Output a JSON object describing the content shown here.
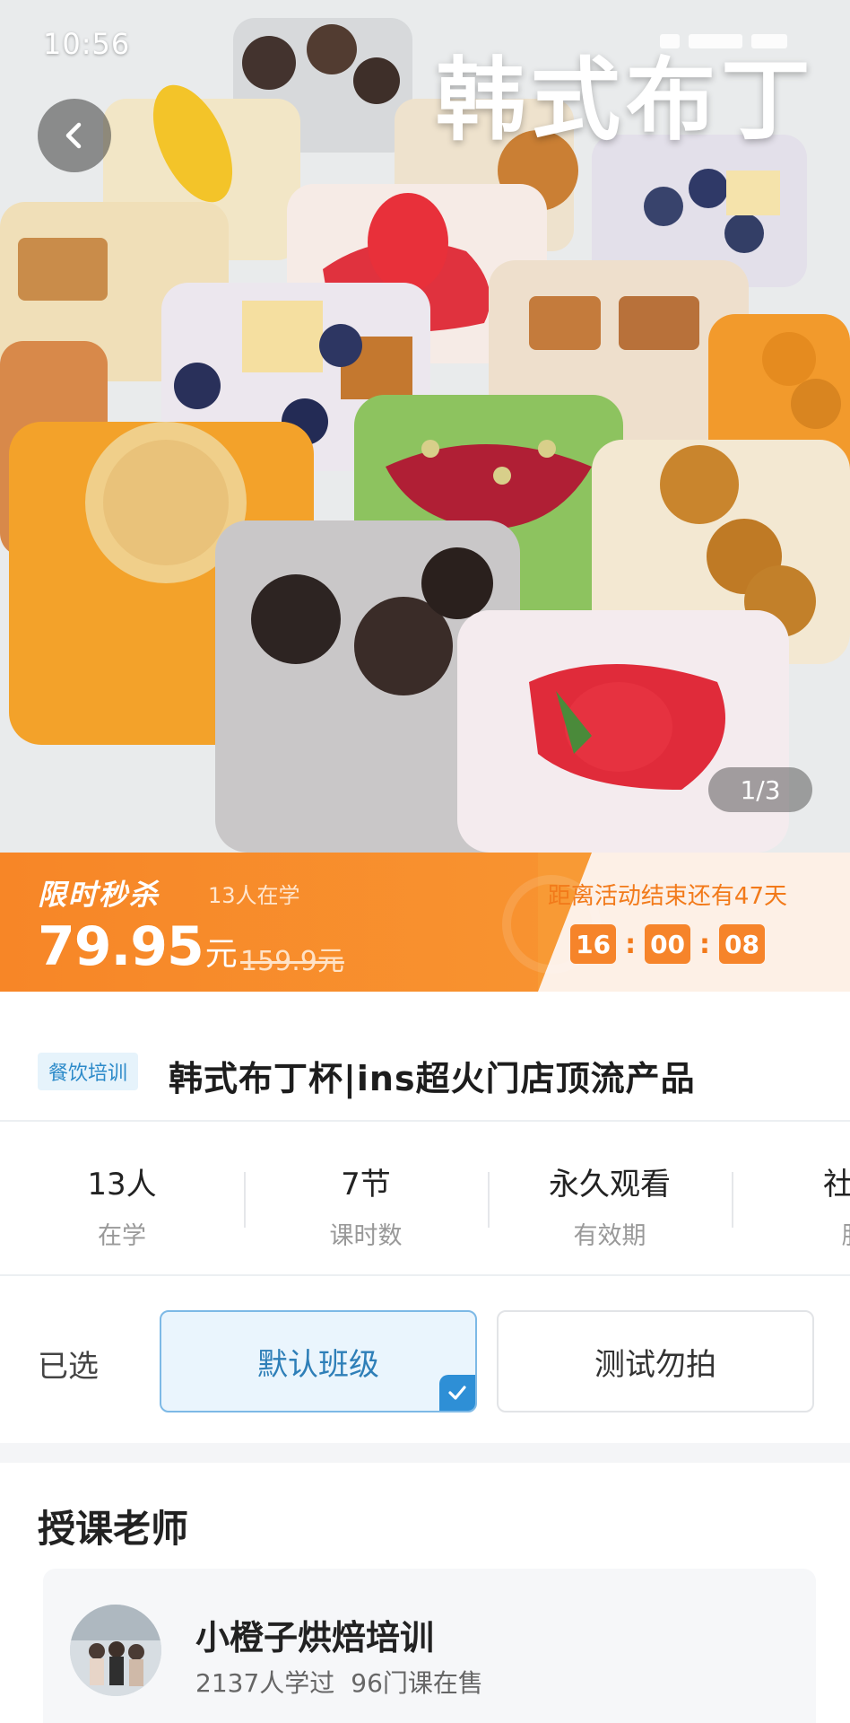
{
  "status_bar": {
    "time": "10:56"
  },
  "hero": {
    "title": "韩式布丁",
    "pager": "1/3",
    "back_icon": "chevron-left-icon"
  },
  "promo": {
    "label": "限时秒杀",
    "learners": "13人在学",
    "price": "79.95",
    "price_unit": "元",
    "original_price": "159.9元",
    "countdown_label": "距离活动结束还有47天",
    "countdown": {
      "hours": "16",
      "minutes": "00",
      "seconds": "08",
      "sep": ":"
    },
    "colors": {
      "accent": "#f78627",
      "panel": "#fdf0e6"
    }
  },
  "course": {
    "tag": "餐饮培训",
    "title": "韩式布丁杯|ins超火门店顶流产品"
  },
  "stats": [
    {
      "value": "13人",
      "label": "在学"
    },
    {
      "value": "7节",
      "label": "课时数"
    },
    {
      "value": "永久观看",
      "label": "有效期"
    },
    {
      "value": "社群",
      "label": "服"
    }
  ],
  "class_selector": {
    "label": "已选",
    "options": [
      {
        "label": "默认班级",
        "selected": true
      },
      {
        "label": "测试勿拍",
        "selected": false
      }
    ]
  },
  "teacher": {
    "heading": "授课老师",
    "name": "小橙子烘焙培训",
    "learners": "2137人学过",
    "courses": "96门课在售"
  }
}
